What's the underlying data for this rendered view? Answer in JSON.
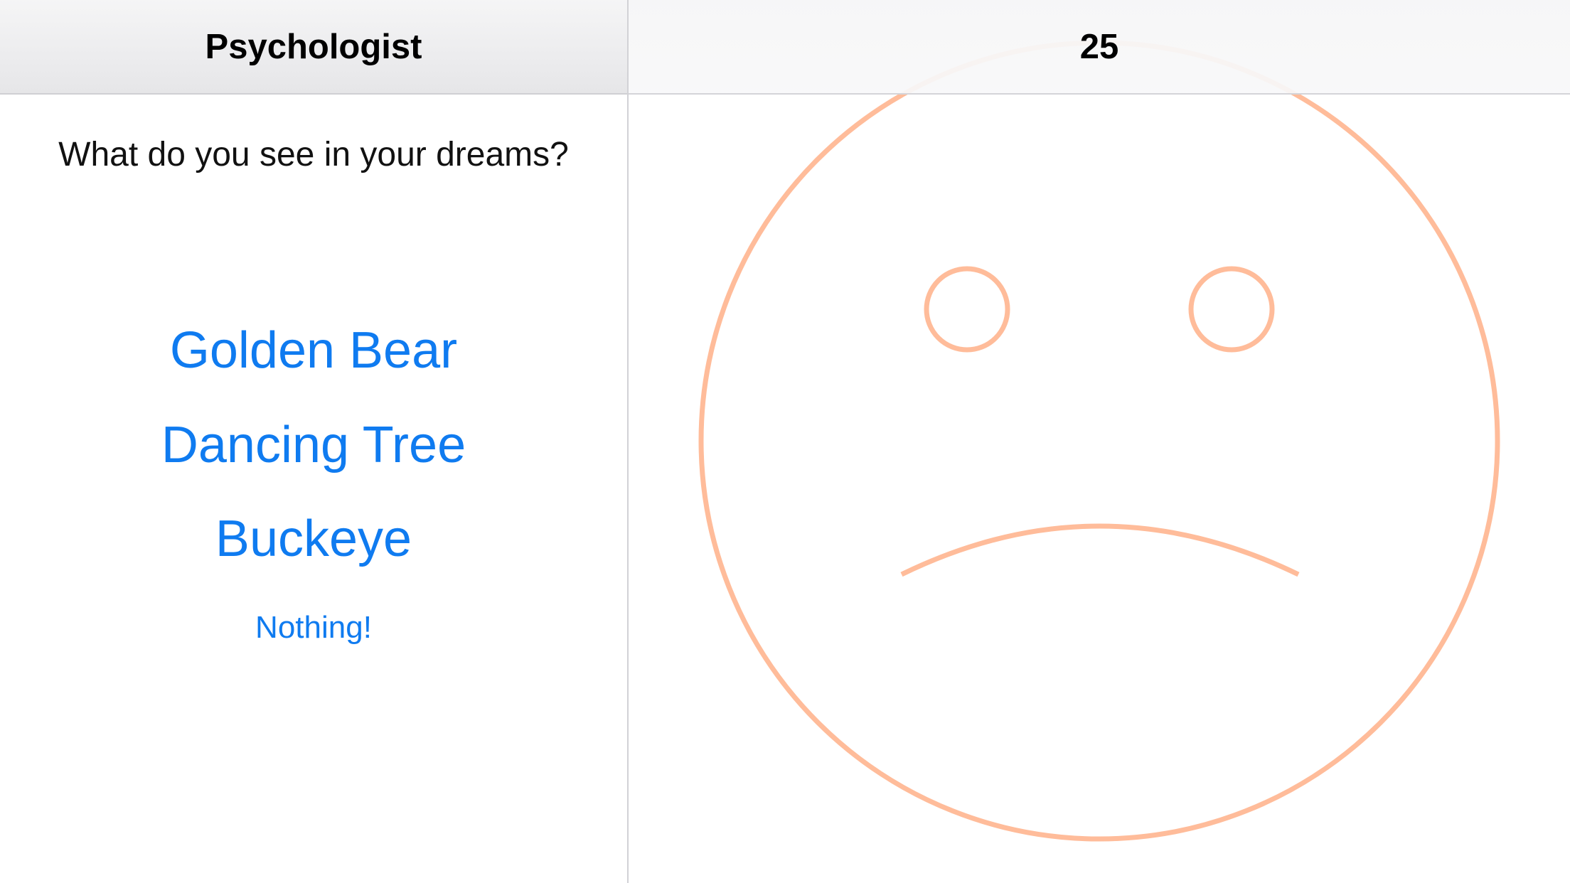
{
  "master": {
    "title": "Psychologist",
    "question": "What do you see in your dreams?",
    "answers": [
      {
        "label": "Golden Bear"
      },
      {
        "label": "Dancing Tree"
      },
      {
        "label": "Buckeye"
      },
      {
        "label": "Nothing!"
      }
    ]
  },
  "detail": {
    "title": "25",
    "face": {
      "mood": "sad",
      "stroke_color": "#ffbc9a"
    }
  },
  "colors": {
    "accent": "#0f7bf0",
    "face": "#ffbc9a"
  }
}
